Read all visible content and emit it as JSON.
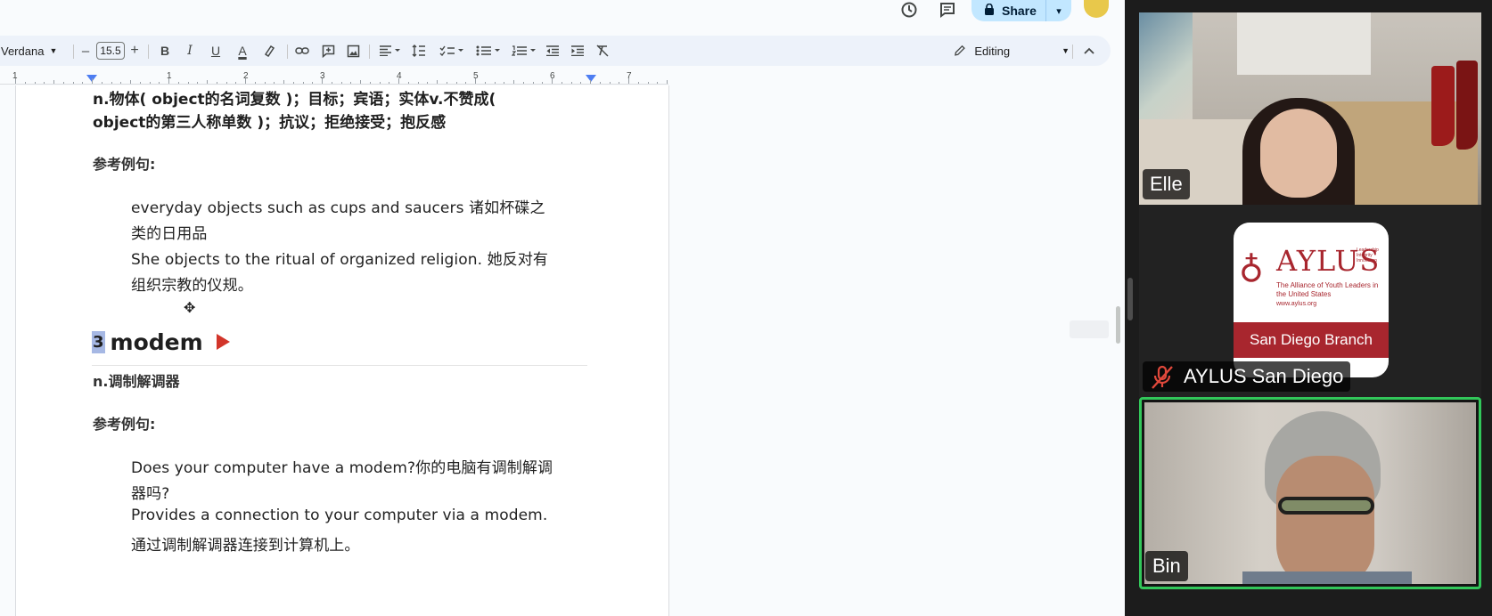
{
  "docs": {
    "top_icons": [
      "history-icon",
      "comment-icon"
    ],
    "share_label": "Share",
    "toolbar": {
      "font_name": "Verdana",
      "font_minus": "–",
      "font_size": "15.5",
      "font_plus": "+",
      "bold": "B",
      "italic": "I",
      "underline": "U",
      "text_color": "A",
      "editing_label": "Editing"
    },
    "ruler": [
      "1",
      "1",
      "2",
      "3",
      "4",
      "5",
      "6",
      "7"
    ],
    "content": {
      "line1": "n.物体( object的名词复数 )；目标；宾语；实体v.不赞成(",
      "line2": "object的第三人称单数 )；抗议；拒绝接受；抱反感",
      "ref1": "参考例句:",
      "ex1a": "everyday objects such as cups and saucers 诸如杯碟之",
      "ex1b": "类的日用品",
      "ex1c": "She objects to the ritual of organized religion. 她反对有",
      "ex1d": "组织宗教的仪规。",
      "heading_num": "3",
      "heading_word": "modem",
      "def2": "n.调制解调器",
      "ref2": "参考例句:",
      "ex2a": "Does your computer have a modem?你的电脑有调制解调",
      "ex2b": "器吗?",
      "ex2c": "Provides a connection to your computer via a modem.",
      "ex2d": "通过调制解调器连接到计算机上。"
    },
    "colors": {
      "toolbar_bg": "#edf2fa",
      "share_bg": "#c2e7ff",
      "heading_highlight": "#a6b8e4",
      "play_icon": "#d2352a"
    }
  },
  "zoom": {
    "participants": [
      {
        "name": "Elle"
      },
      {
        "name": "AYLUS San Diego",
        "muted": true
      },
      {
        "name": "Bin",
        "active_speaker": true
      }
    ],
    "aylus_logo": {
      "word": "AYLUS",
      "tagline": "Leadership Integrity Innovation",
      "subtitle": "The Alliance of Youth Leaders in the United States",
      "url": "www.aylus.org",
      "branch": "San Diego Branch"
    },
    "colors": {
      "gallery_bg": "#1c1c1c",
      "active_border": "#32c75a",
      "aylus_red": "#a8262e"
    }
  }
}
